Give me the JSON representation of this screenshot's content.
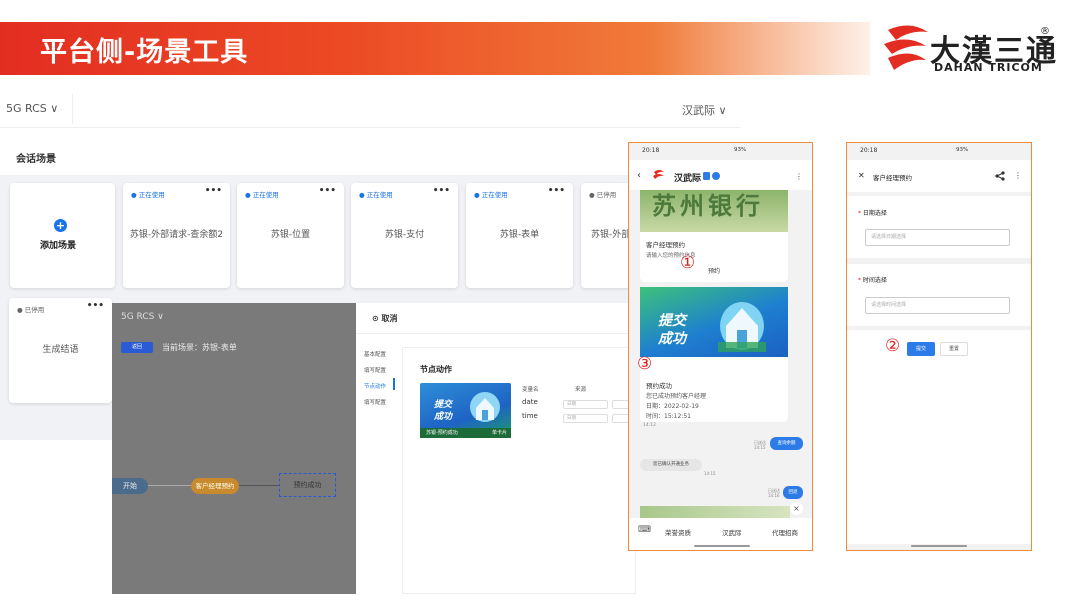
{
  "slide": {
    "title": "平台侧-场景工具",
    "logo_cn": "大漢三通",
    "logo_en": "DAHAN TRICOM",
    "logo_reg": "®"
  },
  "colors": {
    "brand_red": "#e32d22",
    "accent_blue": "#1a73e8",
    "highlight_orange": "#f08a3c",
    "callout_red": "#e0201a"
  },
  "console": {
    "product": "5G RCS ∨",
    "user": "汉武际 ∨",
    "section_title": "会话场景",
    "add_label": "添加场景",
    "add_icon": "plus-circle-icon",
    "cards": [
      {
        "status": "● 正在使用",
        "name": "苏银-外部请求-查余额2",
        "more": "•••"
      },
      {
        "status": "● 正在使用",
        "name": "苏银-位置",
        "more": "•••"
      },
      {
        "status": "● 正在使用",
        "name": "苏银-支付",
        "more": "•••"
      },
      {
        "status": "● 正在使用",
        "name": "苏银-表单",
        "more": "•••"
      },
      {
        "status": "● 已停用",
        "name": "苏银-外部",
        "more": ""
      },
      {
        "status": "● 已停用",
        "name": "生成结语",
        "more": "•••"
      }
    ]
  },
  "flow": {
    "product": "5G RCS ∨",
    "tag": "返回",
    "current_scene": "当前场景：苏银-表单",
    "start": "开始",
    "node1": "客户经理预约",
    "node2": "预约成功"
  },
  "editor": {
    "cancel": "⊙  取消",
    "nav": [
      "基本配置",
      "填写配置",
      "节点动作",
      "填写配置"
    ],
    "node_title": "节点动作",
    "card_text": "提交\n成功",
    "card_bar": "苏银-预约成功",
    "card_bar_right": "单卡片",
    "col_var": "变量名",
    "col_src": "来源",
    "vars": [
      {
        "name": "date",
        "select": "日期"
      },
      {
        "name": "time",
        "select": "日期"
      }
    ]
  },
  "phone1": {
    "status_time": "20:18",
    "status_right": "93%",
    "contact": "汉武际",
    "bank_text": "苏州银行",
    "card1_title": "客户经理预约",
    "card1_desc": "请输入您的预约信息",
    "card1_btn": "预约",
    "submit_text": "提交\n成功",
    "card2_title": "预约成功",
    "card2_lines": [
      "您已成功预约客户经理",
      "日期：2022-02-19",
      "时间：15:12:51"
    ],
    "time1": "14:12",
    "bubble1": "查询余额",
    "bubble1_meta": "已送达\n14:15",
    "bubble2": "您已确认开通业务",
    "bubble2_time": "14:15",
    "bubble3": "回退",
    "bubble3_meta": "已送达\n14:16",
    "tabs": [
      "荣誉资质",
      "汉武际",
      "代理招商"
    ],
    "callout1": "①",
    "callout3": "③"
  },
  "phone2": {
    "status_time": "20:18",
    "status_right": "93%",
    "title": "客户经理预约",
    "date_label": "日期选择",
    "date_placeholder": "请选择日期选择",
    "time_label": "时间选择",
    "time_placeholder": "请选择时间选择",
    "submit": "提交",
    "reset": "重置",
    "callout2": "②"
  }
}
